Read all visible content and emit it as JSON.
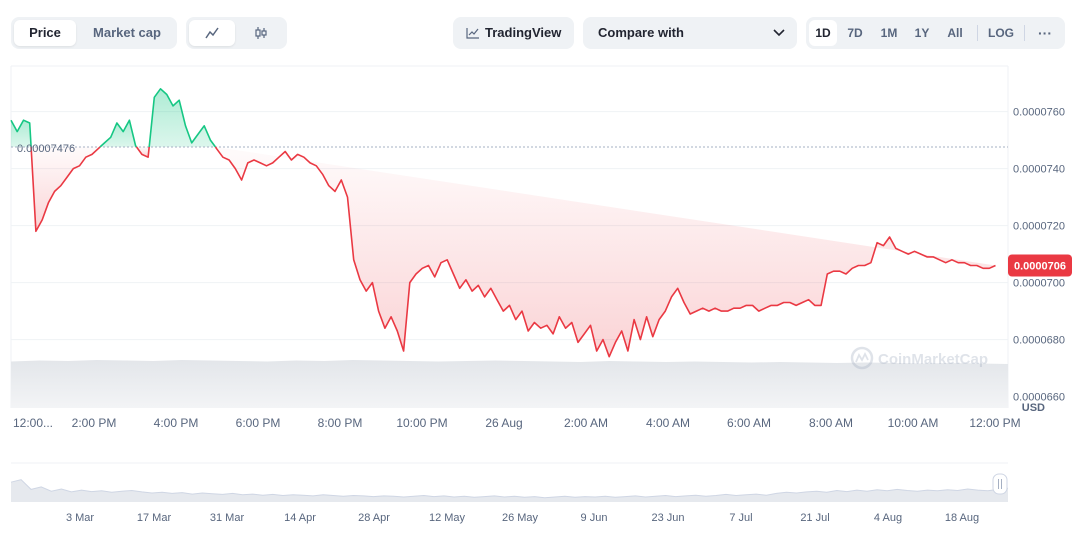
{
  "toolbar": {
    "price_tab": "Price",
    "market_cap_tab": "Market cap",
    "line_icon": "line-chart-icon",
    "candle_icon": "candlestick-icon",
    "tradingview_label": "TradingView",
    "tradingview_icon": "tradingview-chart-icon",
    "compare_label": "Compare with",
    "compare_icon": "chevron-down-icon",
    "ranges": [
      "1D",
      "7D",
      "1M",
      "1Y",
      "All"
    ],
    "active_range": "1D",
    "log_label": "LOG",
    "more_icon": "more-horizontal-icon"
  },
  "colors": {
    "up": "#16c784",
    "down": "#ea3943",
    "grid": "#eff2f5",
    "axis_text": "#58667e"
  },
  "watermark": "CoinMarketCap",
  "chart_data": [
    {
      "type": "line",
      "reference_label": "0.00007476",
      "reference_value": 7.476e-05,
      "current_price_label": "0.0000706",
      "current_value": 7.06e-05,
      "y_unit": "USD",
      "y_ticks": [
        "0.0000760",
        "0.0000740",
        "0.0000720",
        "0.0000700",
        "0.0000680",
        "0.0000660"
      ],
      "ylim": [
        6.56e-05,
        7.76e-05
      ],
      "x_tick_labels": [
        "12:00...",
        "2:00 PM",
        "4:00 PM",
        "6:00 PM",
        "8:00 PM",
        "10:00 PM",
        "26 Aug",
        "2:00 AM",
        "4:00 AM",
        "6:00 AM",
        "8:00 AM",
        "10:00 AM",
        "12:00 PM"
      ],
      "x_hours": [
        0,
        24
      ],
      "grid": true,
      "x": [
        0,
        0.15,
        0.3,
        0.45,
        0.6,
        0.75,
        0.9,
        1.05,
        1.2,
        1.35,
        1.5,
        1.65,
        1.8,
        1.95,
        2.1,
        2.25,
        2.4,
        2.55,
        2.7,
        2.85,
        3.0,
        3.15,
        3.3,
        3.45,
        3.6,
        3.75,
        3.9,
        4.05,
        4.2,
        4.35,
        4.5,
        4.65,
        4.8,
        4.95,
        5.1,
        5.25,
        5.4,
        5.55,
        5.7,
        5.85,
        6.0,
        6.15,
        6.3,
        6.45,
        6.6,
        6.75,
        6.9,
        7.05,
        7.2,
        7.35,
        7.5,
        7.65,
        7.8,
        7.95,
        8.1,
        8.25,
        8.4,
        8.55,
        8.7,
        8.85,
        9.0,
        9.15,
        9.3,
        9.45,
        9.6,
        9.75,
        9.9,
        10.05,
        10.2,
        10.35,
        10.5,
        10.65,
        10.8,
        10.95,
        11.1,
        11.25,
        11.4,
        11.55,
        11.7,
        11.85,
        12.0,
        12.15,
        12.3,
        12.45,
        12.6,
        12.75,
        12.9,
        13.05,
        13.2,
        13.35,
        13.5,
        13.65,
        13.8,
        13.95,
        14.1,
        14.25,
        14.4,
        14.55,
        14.7,
        14.85,
        15.0,
        15.15,
        15.3,
        15.45,
        15.6,
        15.75,
        15.9,
        16.05,
        16.2,
        16.35,
        16.5,
        16.65,
        16.8,
        16.95,
        17.1,
        17.25,
        17.4,
        17.55,
        17.7,
        17.85,
        18.0,
        18.15,
        18.3,
        18.45,
        18.6,
        18.75,
        18.9,
        19.05,
        19.2,
        19.35,
        19.5,
        19.65,
        19.8,
        19.95,
        20.1,
        20.25,
        20.4,
        20.55,
        20.7,
        20.85,
        21.0,
        21.15,
        21.3,
        21.45,
        21.6,
        21.75,
        21.9,
        22.05,
        22.2,
        22.35,
        22.5,
        22.65,
        22.8,
        22.95,
        23.1,
        23.25,
        23.4,
        23.55,
        23.7,
        23.85,
        24.0
      ],
      "y": [
        7.57e-05,
        7.53e-05,
        7.57e-05,
        7.56e-05,
        7.18e-05,
        7.22e-05,
        7.28e-05,
        7.32e-05,
        7.34e-05,
        7.37e-05,
        7.4e-05,
        7.41e-05,
        7.44e-05,
        7.45e-05,
        7.47e-05,
        7.49e-05,
        7.51e-05,
        7.56e-05,
        7.53e-05,
        7.57e-05,
        7.48e-05,
        7.45e-05,
        7.44e-05,
        7.65e-05,
        7.68e-05,
        7.66e-05,
        7.62e-05,
        7.64e-05,
        7.55e-05,
        7.49e-05,
        7.52e-05,
        7.55e-05,
        7.5e-05,
        7.47e-05,
        7.44e-05,
        7.43e-05,
        7.4e-05,
        7.36e-05,
        7.42e-05,
        7.43e-05,
        7.42e-05,
        7.41e-05,
        7.42e-05,
        7.44e-05,
        7.46e-05,
        7.43e-05,
        7.45e-05,
        7.44e-05,
        7.42e-05,
        7.41e-05,
        7.38e-05,
        7.34e-05,
        7.32e-05,
        7.36e-05,
        7.3e-05,
        7.08e-05,
        7.01e-05,
        6.97e-05,
        7e-05,
        6.9e-05,
        6.84e-05,
        6.88e-05,
        6.83e-05,
        6.76e-05,
        7e-05,
        7.03e-05,
        7.05e-05,
        7.06e-05,
        7.02e-05,
        7.07e-05,
        7.08e-05,
        7.03e-05,
        6.98e-05,
        7.01e-05,
        6.97e-05,
        6.99e-05,
        6.95e-05,
        6.98e-05,
        6.94e-05,
        6.9e-05,
        6.92e-05,
        6.87e-05,
        6.9e-05,
        6.83e-05,
        6.86e-05,
        6.84e-05,
        6.85e-05,
        6.82e-05,
        6.88e-05,
        6.84e-05,
        6.86e-05,
        6.79e-05,
        6.82e-05,
        6.85e-05,
        6.76e-05,
        6.8e-05,
        6.74e-05,
        6.79e-05,
        6.83e-05,
        6.76e-05,
        6.87e-05,
        6.8e-05,
        6.88e-05,
        6.81e-05,
        6.87e-05,
        6.9e-05,
        6.95e-05,
        6.98e-05,
        6.93e-05,
        6.89e-05,
        6.9e-05,
        6.91e-05,
        6.9e-05,
        6.91e-05,
        6.9e-05,
        6.9e-05,
        6.91e-05,
        6.91e-05,
        6.92e-05,
        6.92e-05,
        6.9e-05,
        6.91e-05,
        6.92e-05,
        6.92e-05,
        6.93e-05,
        6.93e-05,
        6.92e-05,
        6.93e-05,
        6.94e-05,
        6.92e-05,
        6.92e-05,
        7.03e-05,
        7.04e-05,
        7.04e-05,
        7.03e-05,
        7.05e-05,
        7.06e-05,
        7.06e-05,
        7.07e-05,
        7.14e-05,
        7.13e-05,
        7.16e-05,
        7.12e-05,
        7.11e-05,
        7.1e-05,
        7.11e-05,
        7.1e-05,
        7.09e-05,
        7.09e-05,
        7.08e-05,
        7.07e-05,
        7.08e-05,
        7.07e-05,
        7.07e-05,
        7.06e-05,
        7.06e-05,
        7.05e-05,
        7.05e-05,
        7.06e-05
      ],
      "volume_relative": [
        0.93,
        0.95,
        0.94,
        0.96,
        0.95,
        0.94,
        0.96,
        0.95,
        0.94,
        0.93,
        0.95,
        0.94,
        0.96,
        0.95,
        0.94,
        0.93,
        0.94,
        0.95,
        0.94,
        0.93,
        0.92,
        0.94,
        0.93,
        0.92,
        0.93,
        0.92,
        0.91,
        0.92,
        0.91,
        0.9,
        0.91,
        0.9,
        0.89,
        0.9,
        0.89,
        0.88
      ],
      "overview": {
        "x_tick_labels": [
          "3 Mar",
          "17 Mar",
          "31 Mar",
          "14 Apr",
          "28 Apr",
          "12 May",
          "26 May",
          "9 Jun",
          "23 Jun",
          "7 Jul",
          "21 Jul",
          "4 Aug",
          "18 Aug"
        ],
        "values_relative": [
          0.55,
          0.62,
          0.35,
          0.42,
          0.3,
          0.36,
          0.28,
          0.33,
          0.29,
          0.31,
          0.27,
          0.3,
          0.32,
          0.28,
          0.25,
          0.27,
          0.24,
          0.26,
          0.22,
          0.25,
          0.23,
          0.21,
          0.24,
          0.2,
          0.22,
          0.19,
          0.21,
          0.18,
          0.2,
          0.19,
          0.17,
          0.2,
          0.18,
          0.16,
          0.18,
          0.17,
          0.15,
          0.17,
          0.16,
          0.14,
          0.16,
          0.18,
          0.15,
          0.17,
          0.14,
          0.16,
          0.13,
          0.15,
          0.17,
          0.14,
          0.16,
          0.13,
          0.15,
          0.12,
          0.14,
          0.16,
          0.13,
          0.15,
          0.14,
          0.16,
          0.13,
          0.15,
          0.17,
          0.14,
          0.16,
          0.18,
          0.15,
          0.17,
          0.19,
          0.16,
          0.18,
          0.21,
          0.18,
          0.2,
          0.22,
          0.19,
          0.24,
          0.27,
          0.25,
          0.28,
          0.3,
          0.27,
          0.32,
          0.29,
          0.33,
          0.3,
          0.34,
          0.31,
          0.35,
          0.32,
          0.3,
          0.33,
          0.31,
          0.34,
          0.32,
          0.36,
          0.33,
          0.31,
          0.35,
          0.38
        ]
      }
    }
  ]
}
